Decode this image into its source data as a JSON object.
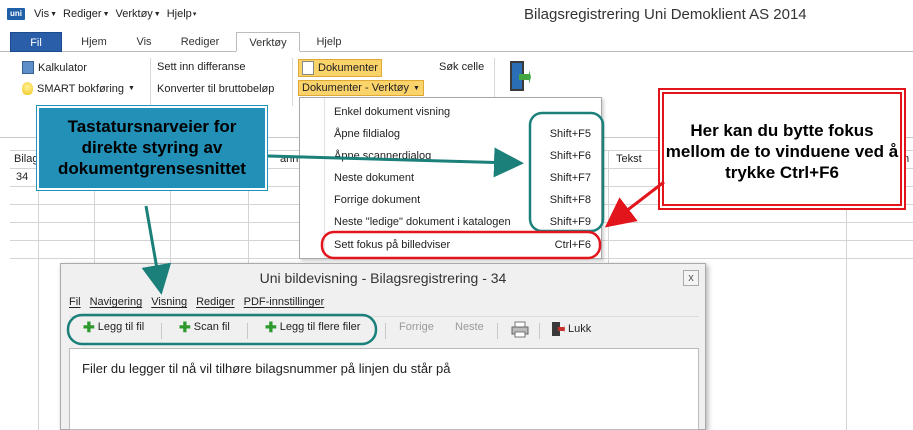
{
  "app": {
    "logo": "uni",
    "title": "Bilagsregistrering Uni Demoklient AS 2014",
    "quick_access": [
      "Vis",
      "Rediger",
      "Verktøy",
      "Hjelp"
    ]
  },
  "tabs": [
    {
      "label": "Fil"
    },
    {
      "label": "Hjem"
    },
    {
      "label": "Vis"
    },
    {
      "label": "Rediger"
    },
    {
      "label": "Verktøy"
    },
    {
      "label": "Hjelp"
    }
  ],
  "ribbon": {
    "kalkulator": "Kalkulator",
    "smart": "SMART bokføring",
    "sett_inn": "Sett inn differanse",
    "konverter": "Konverter til bruttobeløp",
    "dokumenter": "Dokumenter",
    "dokumenter_verktoy": "Dokumenter - Verktøy",
    "sok_celle": "Søk celle"
  },
  "grid": {
    "col1": "Bilag",
    "col_ann": "ann",
    "col_tekst": "Tekst",
    "col_m": "m",
    "row1_value": "34"
  },
  "dropdown": {
    "items": [
      {
        "label": "Enkel dokument visning",
        "key": ""
      },
      {
        "label": "Åpne fildialog",
        "key": "Shift+F5"
      },
      {
        "label": "Åpne scannerdialog",
        "key": "Shift+F6"
      },
      {
        "label": "Neste dokument",
        "key": "Shift+F7"
      },
      {
        "label": "Forrige dokument",
        "key": "Shift+F8"
      },
      {
        "label": "Neste \"ledige\" dokument i katalogen",
        "key": "Shift+F9"
      },
      {
        "label": "Sett fokus på billedviser",
        "key": "Ctrl+F6"
      }
    ]
  },
  "callouts": {
    "blue": "Tastatursnarveier for direkte styring av dokumentgrensesnittet",
    "red": "Her kan du bytte fokus mellom de to vinduene ved å trykke Ctrl+F6"
  },
  "viewer": {
    "title": "Uni bildevisning - Bilagsregistrering - 34",
    "close": "x",
    "menu": [
      "Fil",
      "Navigering",
      "Visning",
      "Rediger",
      "PDF-innstillinger"
    ],
    "toolbar": {
      "legg_til": "Legg til fil",
      "scan": "Scan fil",
      "legg_til_flere": "Legg til flere filer",
      "forrige": "Forrige",
      "neste": "Neste",
      "lukk": "Lukk"
    },
    "message": "Filer du legger til nå vil tilhøre bilagsnummer på linjen du står på"
  },
  "colors": {
    "accent_blue": "#2a5ea8",
    "callout_teal": "#2390b8",
    "annotation_teal": "#1b7f7a",
    "annotation_red": "#e3151c",
    "highlight": "#fbd36b"
  }
}
